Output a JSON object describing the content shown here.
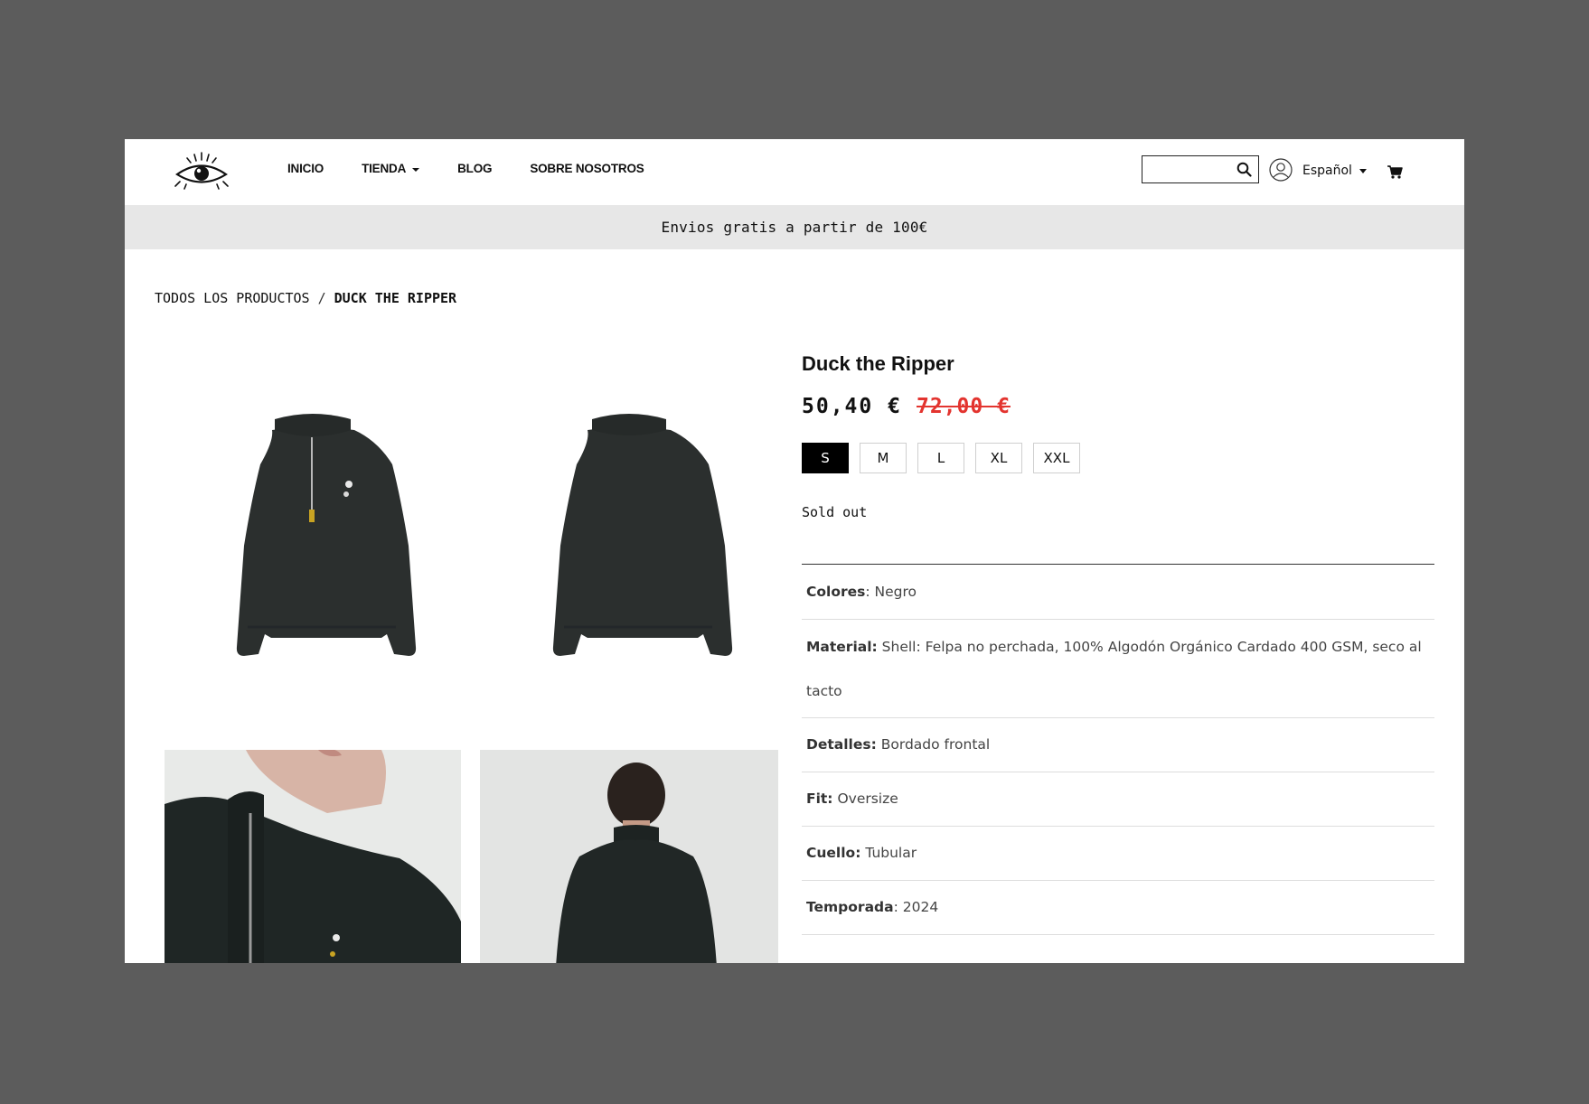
{
  "header": {
    "logo_icon": "eye-logo-icon",
    "nav": [
      {
        "label": "INICIO",
        "dropdown": false
      },
      {
        "label": "TIENDA",
        "dropdown": true
      },
      {
        "label": "BLOG",
        "dropdown": false
      },
      {
        "label": "SOBRE NOSOTROS",
        "dropdown": false
      }
    ],
    "search": {
      "value": "",
      "placeholder": ""
    },
    "language": "Español"
  },
  "banner": {
    "text": "Envios gratis a partir de 100€"
  },
  "breadcrumb": {
    "parent": "TODOS LOS PRODUCTOS",
    "separator": "/",
    "current": "DUCK THE RIPPER"
  },
  "product": {
    "title": "Duck the Ripper",
    "price": "50,40 €",
    "old_price": "72,00 €",
    "sizes": [
      "S",
      "M",
      "L",
      "XL",
      "XXL"
    ],
    "selected_size": "S",
    "stock_status": "Sold out",
    "specs": [
      {
        "label": "Colores",
        "value": ": Negro"
      },
      {
        "label": "Material:",
        "value": " Shell: Felpa no perchada, 100% Algodón Orgánico Cardado 400 GSM, seco al tacto"
      },
      {
        "label": "Detalles:",
        "value": " Bordado frontal"
      },
      {
        "label": "Fit:",
        "value": " Oversize"
      },
      {
        "label": "Cuello:",
        "value": " Tubular"
      },
      {
        "label": "Temporada",
        "value": ": 2024"
      }
    ]
  },
  "colors": {
    "page_bg": "#5c5c5c",
    "banner_bg": "#e7e7e7",
    "sale_red": "#e3342f",
    "garment": "#2b2f2e"
  }
}
